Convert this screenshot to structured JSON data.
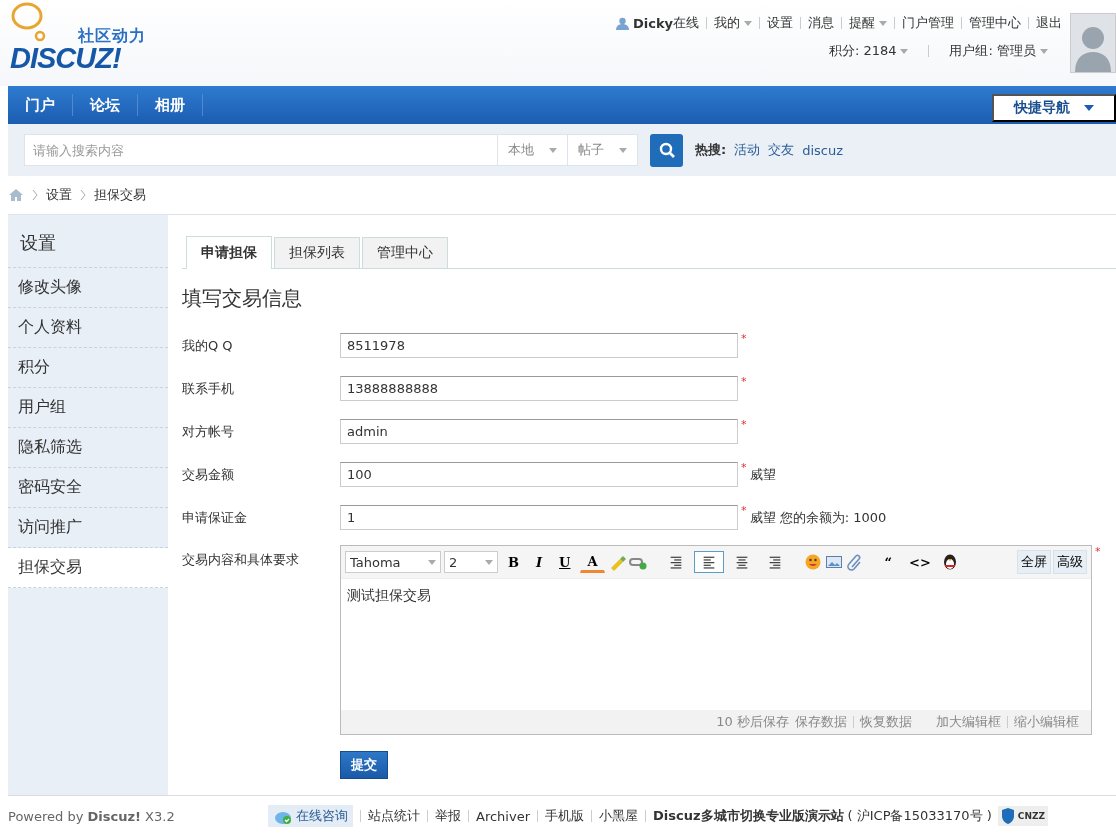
{
  "logo": {
    "tagline": "社区动力",
    "wordmark": "DISCUZ!"
  },
  "user_bar": {
    "username": "Dicky",
    "status": "在线",
    "links": [
      {
        "label": "我的",
        "dropdown": true
      },
      {
        "label": "设置",
        "dropdown": false
      },
      {
        "label": "消息",
        "dropdown": false
      },
      {
        "label": "提醒",
        "dropdown": true
      },
      {
        "label": "门户管理",
        "dropdown": false
      },
      {
        "label": "管理中心",
        "dropdown": false
      },
      {
        "label": "退出",
        "dropdown": false
      }
    ],
    "stats": [
      {
        "label": "积分: 2184",
        "dropdown": true
      },
      {
        "label": "用户组: 管理员",
        "dropdown": true
      }
    ]
  },
  "nav": {
    "items": [
      "门户",
      "论坛",
      "相册"
    ],
    "quick_nav": "快捷导航"
  },
  "search": {
    "placeholder": "请输入搜索内容",
    "scopes": [
      "本地",
      "帖子"
    ],
    "hot_label": "热搜:",
    "hot": [
      "活动",
      "交友",
      "discuz"
    ]
  },
  "breadcrumb": [
    "设置",
    "担保交易"
  ],
  "sidebar": {
    "title": "设置",
    "items": [
      {
        "label": "修改头像",
        "selected": false
      },
      {
        "label": "个人资料",
        "selected": false
      },
      {
        "label": "积分",
        "selected": false
      },
      {
        "label": "用户组",
        "selected": false
      },
      {
        "label": "隐私筛选",
        "selected": false
      },
      {
        "label": "密码安全",
        "selected": false
      },
      {
        "label": "访问推广",
        "selected": false
      },
      {
        "label": "担保交易",
        "selected": true
      }
    ]
  },
  "tabs": [
    {
      "label": "申请担保",
      "selected": true
    },
    {
      "label": "担保列表",
      "selected": false
    },
    {
      "label": "管理中心",
      "selected": false
    }
  ],
  "form": {
    "title": "填写交易信息",
    "fields": [
      {
        "label": "我的Q Q",
        "value": "8511978",
        "mark": "*"
      },
      {
        "label": "联系手机",
        "value": "13888888888",
        "mark": "*"
      },
      {
        "label": "对方帐号",
        "value": "admin",
        "mark": "*"
      },
      {
        "label": "交易金额",
        "value": "100",
        "mark": "*",
        "suffix": "威望"
      },
      {
        "label": "申请保证金",
        "value": "1",
        "mark": "*",
        "suffix": "威望 您的余额为: 1000"
      }
    ],
    "editor": {
      "label": "交易内容和具体要求",
      "mark": "*",
      "font": "Tahoma",
      "size": "2",
      "format_buttons": [
        "B",
        "I",
        "U",
        "A"
      ],
      "align_buttons": [
        {
          "selected": false
        },
        {
          "selected": true
        },
        {
          "selected": false
        },
        {
          "selected": false
        }
      ],
      "insert_buttons": [
        "“",
        "<>"
      ],
      "mode_buttons": [
        "全屏",
        "高级"
      ],
      "content": "测试担保交易",
      "autosave": "10 秒后保存",
      "actions": [
        [
          "保存数据",
          "恢复数据"
        ],
        [
          "加大编辑框",
          "缩小编辑框"
        ]
      ]
    },
    "submit": "提交"
  },
  "footer": {
    "powered": "Powered by **Discuz!** X3.2",
    "consult": "在线咨询",
    "links": [
      "站点统计",
      "举报",
      "Archiver",
      "手机版",
      "小黑屋"
    ],
    "site": "Discuz多城市切换专业版演示站",
    "icp": "( 沪ICP备15033170号 )",
    "badge": "CNZZ"
  }
}
